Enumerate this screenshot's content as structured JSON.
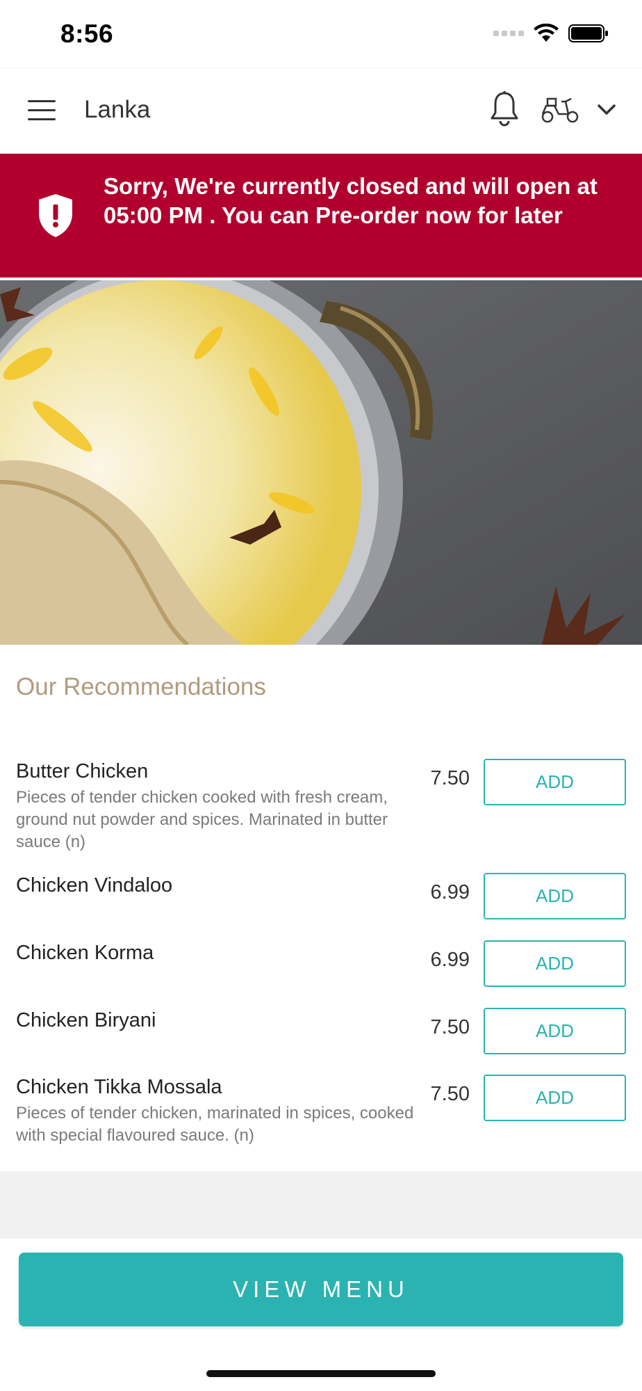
{
  "status_bar": {
    "time": "8:56"
  },
  "nav": {
    "store_name": "Lanka",
    "icons": [
      "menu-icon",
      "bell-icon",
      "delivery-scooter-icon",
      "chevron-down-icon"
    ]
  },
  "banner": {
    "message": "Sorry, We're currently closed and will open at 05:00 PM . You can Pre-order now for later",
    "icon": "shield-alert-icon",
    "color": "#b1002d"
  },
  "recommendations": {
    "title": "Our Recommendations",
    "items": [
      {
        "name": "Butter Chicken",
        "description": "Pieces of tender chicken cooked with fresh cream, ground nut powder and spices. Marinated in butter sauce (n)",
        "price": "7.50",
        "button": "ADD"
      },
      {
        "name": "Chicken Vindaloo",
        "description": "",
        "price": "6.99",
        "button": "ADD"
      },
      {
        "name": "Chicken Korma",
        "description": "",
        "price": "6.99",
        "button": "ADD"
      },
      {
        "name": "Chicken Biryani",
        "description": "",
        "price": "7.50",
        "button": "ADD"
      },
      {
        "name": "Chicken Tikka Mossala",
        "description": "Pieces of tender chicken, marinated in spices, cooked with special flavoured sauce. (n)",
        "price": "7.50",
        "button": "ADD"
      }
    ]
  },
  "footer": {
    "view_menu_label": "VIEW MENU"
  },
  "colors": {
    "accent": "#2ab3b1",
    "title": "#b19b7d",
    "banner": "#b1002d"
  }
}
